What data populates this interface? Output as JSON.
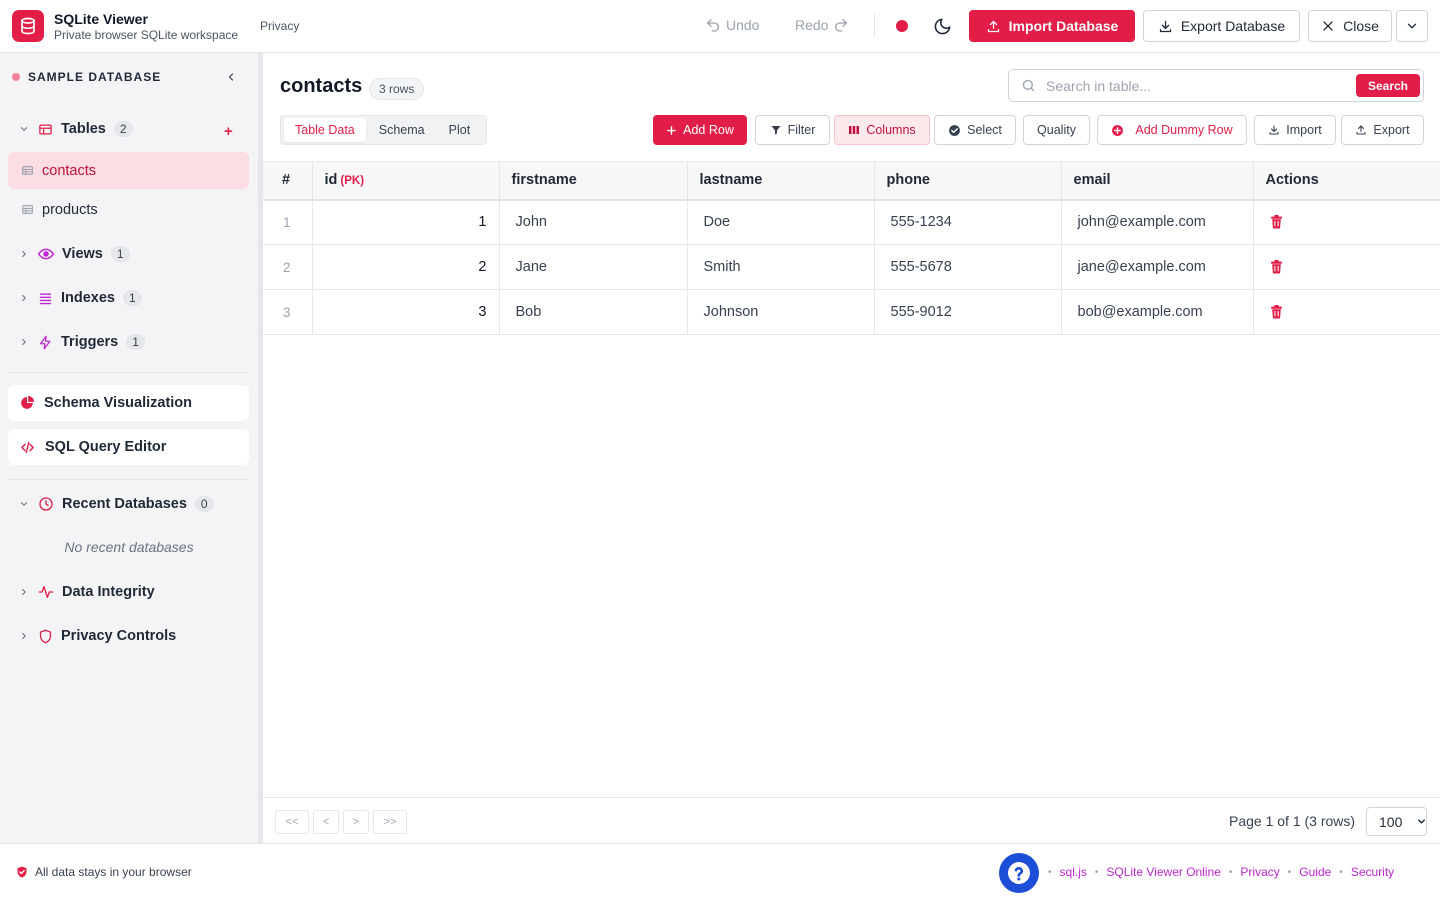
{
  "header": {
    "app_title": "SQLite Viewer",
    "app_subtitle": "Private browser SQLite workspace",
    "privacy_link": "Privacy",
    "undo_label": "Undo",
    "redo_label": "Redo",
    "import_label": "Import Database",
    "export_label": "Export Database",
    "close_label": "Close"
  },
  "sidebar": {
    "database_name": "SAMPLE DATABASE",
    "tables": {
      "label": "Tables",
      "count": "2",
      "items": [
        {
          "label": "contacts"
        },
        {
          "label": "products"
        }
      ]
    },
    "views": {
      "label": "Views",
      "count": "1"
    },
    "indexes": {
      "label": "Indexes",
      "count": "1"
    },
    "triggers": {
      "label": "Triggers",
      "count": "1"
    },
    "schema_viz_label": "Schema Visualization",
    "sql_editor_label": "SQL Query Editor",
    "recent": {
      "label": "Recent Databases",
      "count": "0",
      "empty": "No recent databases"
    },
    "data_integrity_label": "Data Integrity",
    "privacy_controls_label": "Privacy Controls"
  },
  "main": {
    "table_name": "contacts",
    "rows_badge": "3 rows",
    "search_placeholder": "Search in table...",
    "search_button": "Search",
    "tabs": [
      {
        "label": "Table Data"
      },
      {
        "label": "Schema"
      },
      {
        "label": "Plot"
      }
    ],
    "toolbar": {
      "add_row": "Add Row",
      "filter": "Filter",
      "columns": "Columns",
      "select": "Select",
      "quality": "Quality",
      "add_dummy_row": "Add Dummy Row",
      "import": "Import",
      "export": "Export"
    },
    "columns": {
      "num": "#",
      "id": "id",
      "pk": "(PK)",
      "firstname": "firstname",
      "lastname": "lastname",
      "phone": "phone",
      "email": "email",
      "actions": "Actions"
    },
    "rows": [
      {
        "num": "1",
        "id": "1",
        "firstname": "John",
        "lastname": "Doe",
        "phone": "555-1234",
        "email": "john@example.com"
      },
      {
        "num": "2",
        "id": "2",
        "firstname": "Jane",
        "lastname": "Smith",
        "phone": "555-5678",
        "email": "jane@example.com"
      },
      {
        "num": "3",
        "id": "3",
        "firstname": "Bob",
        "lastname": "Johnson",
        "phone": "555-9012",
        "email": "bob@example.com"
      }
    ],
    "pagination": {
      "first": "<<",
      "prev": "<",
      "next": ">",
      "last": ">>",
      "info": "Page 1 of 1 (3 rows)",
      "page_size": "100"
    }
  },
  "footer": {
    "privacy_note": "All data stays in your browser",
    "links": [
      {
        "label": "sql.js"
      },
      {
        "label": "SQLite Viewer Online"
      },
      {
        "label": "Privacy"
      },
      {
        "label": "Guide"
      },
      {
        "label": "Security"
      }
    ]
  },
  "colors": {
    "accent": "#e11d48",
    "accent_soft": "#fbdde3",
    "link": "#c026d3",
    "help": "#1d4ed8"
  },
  "icons": [
    "database-icon",
    "undo-icon",
    "redo-icon",
    "record-icon",
    "moon-icon",
    "upload-icon",
    "download-icon",
    "close-icon",
    "chevron-down-icon",
    "chevron-left-icon",
    "table-icon",
    "eye-icon",
    "list-icon",
    "bolt-icon",
    "pie-icon",
    "code-icon",
    "clock-icon",
    "activity-icon",
    "shield-icon",
    "search-icon",
    "plus-icon",
    "filter-icon",
    "columns-icon",
    "check-circle-icon",
    "plus-circle-icon",
    "trash-icon",
    "help-icon"
  ]
}
